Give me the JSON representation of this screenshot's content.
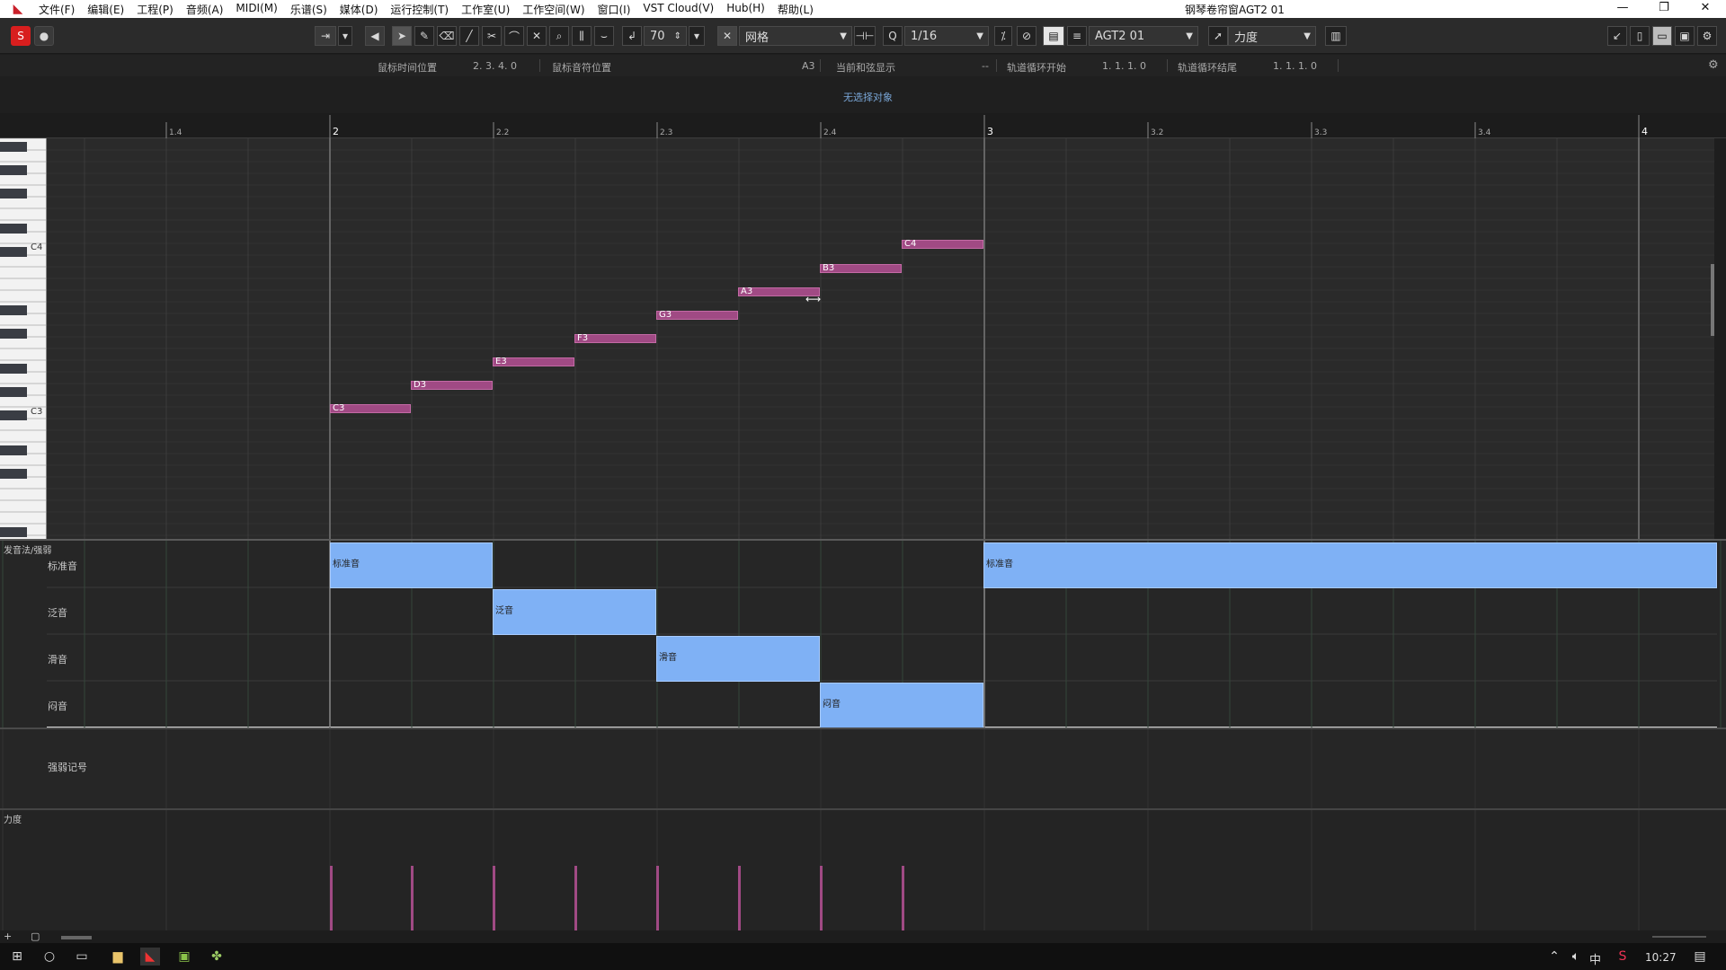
{
  "window": {
    "title": "钢琴卷帘窗AGT2 01",
    "app_icon": "cubase-icon"
  },
  "menu": [
    "文件(F)",
    "编辑(E)",
    "工程(P)",
    "音频(A)",
    "MIDI(M)",
    "乐谱(S)",
    "媒体(D)",
    "运行控制(T)",
    "工作室(U)",
    "工作空间(W)",
    "窗口(I)",
    "VST Cloud(V)",
    "Hub(H)",
    "帮助(L)"
  ],
  "toolbar": {
    "solo_label": "S",
    "record_label": "●",
    "step_value": "70",
    "snap_type": "网格",
    "quantize": "1/16",
    "track": "AGT2 01",
    "controller": "力度"
  },
  "info": {
    "mouse_time_label": "鼠标时间位置",
    "mouse_time_value": "2. 3. 4.  0",
    "mouse_note_label": "鼠标音符位置",
    "mouse_note_value": "A3",
    "current_chord_label": "当前和弦显示",
    "current_chord_value": "--",
    "loop_start_label": "轨道循环开始",
    "loop_start_value": "1. 1. 1.  0",
    "loop_end_label": "轨道循环结尾",
    "loop_end_value": "1. 1. 1.  0"
  },
  "status": {
    "no_selection": "无选择对象"
  },
  "ruler": [
    "1.4",
    "2",
    "2.2",
    "2.3",
    "2.4",
    "3",
    "3.2",
    "3.3",
    "3.4",
    "4"
  ],
  "keys": {
    "c4": "C4",
    "c3": "C3"
  },
  "notes": [
    {
      "name": "C3"
    },
    {
      "name": "D3"
    },
    {
      "name": "E3"
    },
    {
      "name": "F3"
    },
    {
      "name": "G3"
    },
    {
      "name": "A3"
    },
    {
      "name": "B3"
    },
    {
      "name": "C4"
    }
  ],
  "articulations": {
    "lane_title": "发音法/强弱",
    "rows": [
      "标准音",
      "泛音",
      "滑音",
      "闷音"
    ],
    "blocks": [
      "标准音",
      "泛音",
      "滑音",
      "闷音",
      "标准音"
    ],
    "dynamics_label": "强弱记号"
  },
  "velocity": {
    "lane_title": "力度"
  },
  "taskbar": {
    "time": "10:27",
    "ime": "中"
  },
  "colors": {
    "note": "#a04a84",
    "articulation": "#7fb1f5",
    "solo": "#d81e1e"
  }
}
